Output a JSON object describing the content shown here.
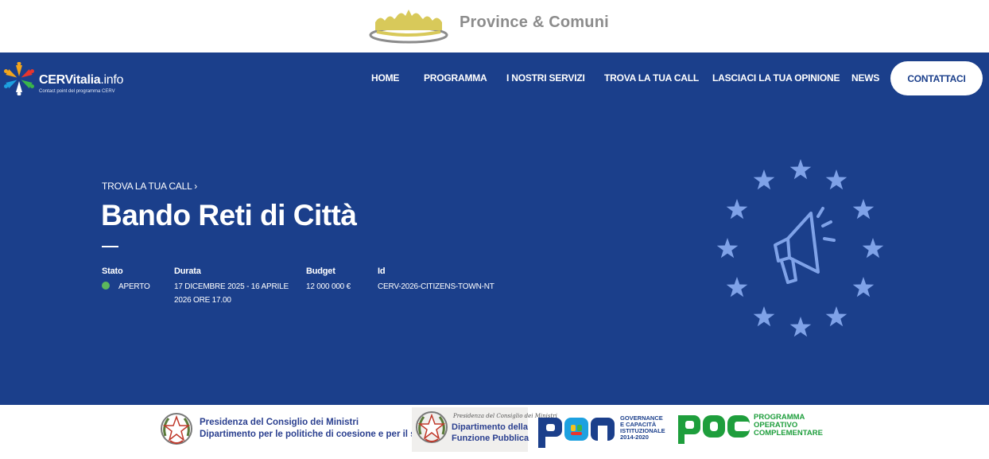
{
  "topbar": {
    "brand_text": "Province & Comuni"
  },
  "header": {
    "brand_name_bold": "CERVitalia",
    "brand_name_thin": ".info",
    "brand_tagline": "Contact point del programma CERV",
    "nav": {
      "home": "HOME",
      "programma": "PROGRAMMA",
      "servizi": "I NOSTRI SERVIZI",
      "trova": "TROVA LA TUA CALL",
      "opinione": "LASCIACI LA TUA OPINIONE",
      "news": "NEWS",
      "contatti": "CONTATTACI"
    }
  },
  "main": {
    "breadcrumb": "TROVA LA TUA CALL ›",
    "title": "Bando Reti di Città",
    "meta": {
      "stato_label": "Stato",
      "stato_value": "APERTO",
      "durata_label": "Durata",
      "durata_line1": "17 DICEMBRE 2025 - 16 APRILE",
      "durata_line2": "2026 ORE 17.00",
      "budget_label": "Budget",
      "budget_value": "12 000 000 €",
      "id_label": "Id",
      "id_value": "CERV-2026-CITIZENS-TOWN-NT"
    },
    "status_color": "#5cb85c"
  },
  "footer": {
    "pcm_line1": "Presidenza del Consiglio dei Ministri",
    "pcm_line2": "Dipartimento per le politiche di coesione e per il sud",
    "dfp_script": "Presidenza del Consiglio dei Ministri",
    "dfp_line1": "Dipartimento della",
    "dfp_line2": "Funzione Pubblica",
    "pon_line1": "GOVERNANCE",
    "pon_line2": "E CAPACITÀ",
    "pon_line3": "ISTITUZIONALE",
    "pon_line4": "2014-2020",
    "poc_line1": "PROGRAMMA",
    "poc_line2": "OPERATIVO",
    "poc_line3": "COMPLEMENTARE"
  },
  "colors": {
    "hero_blue": "#1b3f8b",
    "star_blue": "#7fa2e8",
    "poc_green": "#1e9e3c"
  }
}
